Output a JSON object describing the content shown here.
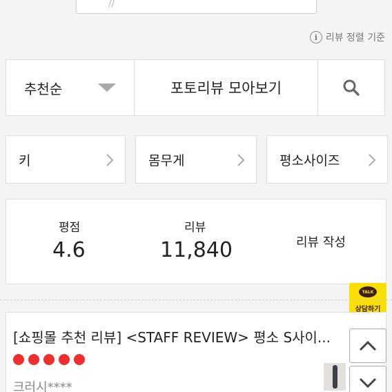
{
  "search": {
    "partial_mark": "//"
  },
  "info": {
    "icon_glyph": "i",
    "label": "리뷰 정렬 기준"
  },
  "filter": {
    "sort_label": "추천순",
    "photo_review_label": "포토리뷰 모아보기",
    "search_icon": "search-icon"
  },
  "chips": [
    {
      "label": "키"
    },
    {
      "label": "몸무게"
    },
    {
      "label": "평소사이즈"
    }
  ],
  "stats": {
    "rating_label": "평점",
    "rating_value": "4.6",
    "review_label": "리뷰",
    "review_count": "11,840",
    "write_label": "리뷰 작성"
  },
  "talk": {
    "badge": "TALK",
    "label": "상담하기",
    "color": "#f9e000"
  },
  "review": {
    "title": "[쇼핑몰 추천 리뷰] <STAFF REVIEW> 평소 S사이...",
    "rating": 5,
    "reviewer": "크러시****"
  },
  "colors": {
    "star": "#ef2e2e",
    "border": "#dddddd",
    "page_bg": "#f4f4f4"
  }
}
